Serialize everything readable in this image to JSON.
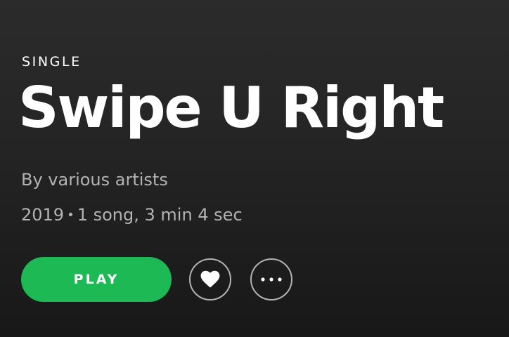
{
  "album": {
    "type_label": "SINGLE",
    "title": "Swipe U Right",
    "byline": "By various artists",
    "year": "2019",
    "separator": "•",
    "summary": "1 song, 3 min 4 sec"
  },
  "actions": {
    "play_label": "PLAY",
    "like_icon": "heart-icon",
    "more_icon": "more-icon"
  },
  "colors": {
    "accent": "#1db954",
    "muted_text": "#b3b3b3",
    "background": "#282828"
  }
}
